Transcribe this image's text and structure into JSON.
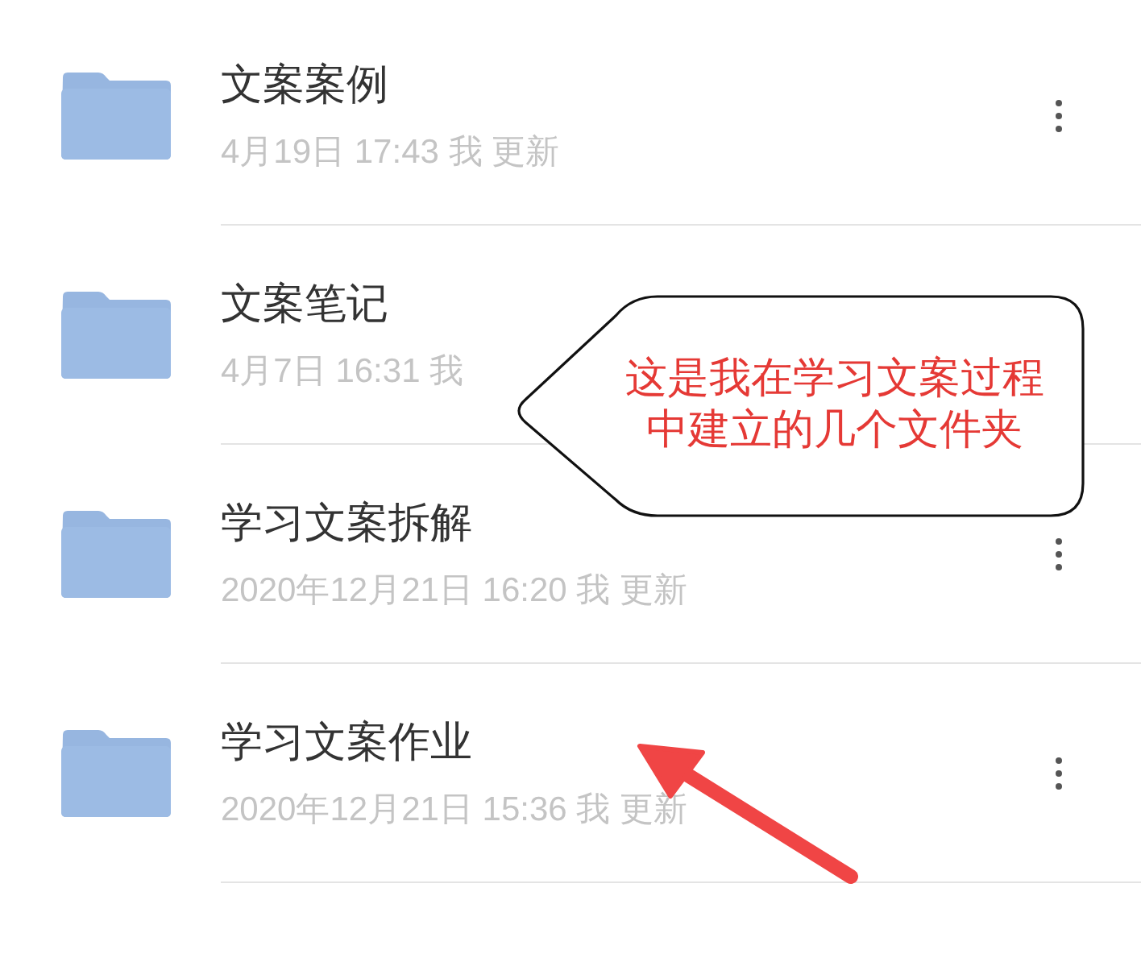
{
  "files": [
    {
      "kind": "folder",
      "name": "文案案例",
      "meta": "4月19日 17:43 我 更新",
      "has_menu": true
    },
    {
      "kind": "folder",
      "name": "文案笔记",
      "meta": "4月7日 16:31 我",
      "has_menu": false
    },
    {
      "kind": "folder",
      "name": "学习文案拆解",
      "meta": "2020年12月21日 16:20 我 更新",
      "has_menu": true
    },
    {
      "kind": "folder",
      "name": "学习文案作业",
      "meta": "2020年12月21日 15:36 我 更新",
      "has_menu": true
    }
  ],
  "callout": {
    "lines": [
      "这是我在学习文案过程",
      "中建立的几个文件夹"
    ]
  }
}
